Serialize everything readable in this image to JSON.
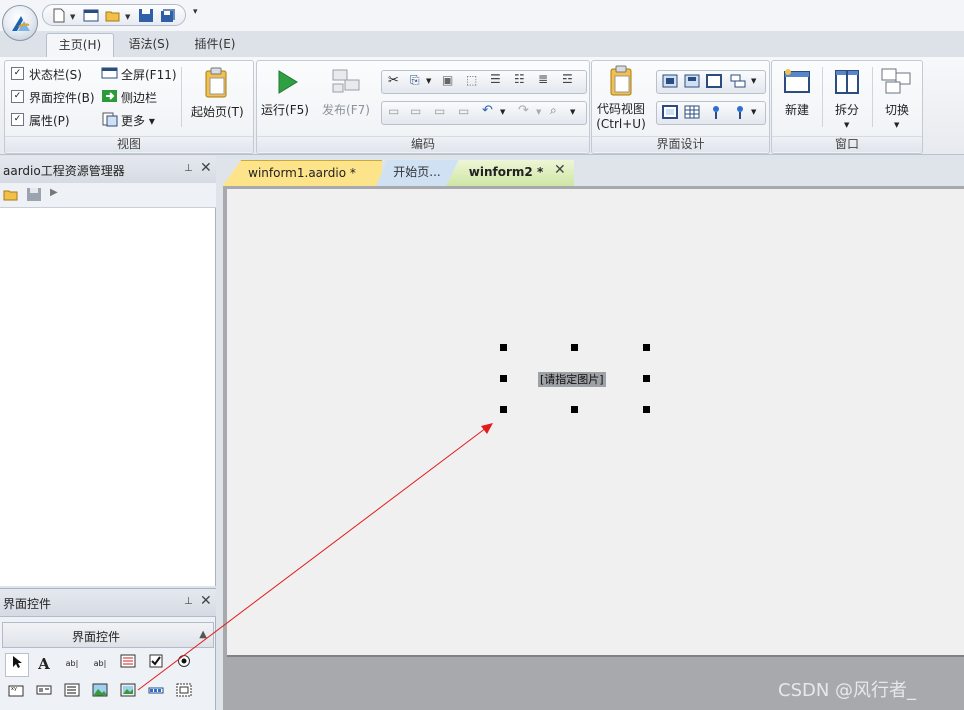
{
  "quick_access": {
    "items": [
      "new-file-icon",
      "form-icon",
      "open-folder-icon",
      "save-icon",
      "save-all-icon"
    ],
    "customize": "▾"
  },
  "ribbon": {
    "tabs": [
      {
        "label": "主页(H)",
        "active": true
      },
      {
        "label": "语法(S)",
        "active": false
      },
      {
        "label": "插件(E)",
        "active": false
      }
    ],
    "view_group": {
      "label": "视图",
      "statusbar": "状态栏(S)",
      "controls": "界面控件(B)",
      "properties": "属性(P)",
      "fullscreen": "全屏(F11)",
      "sidebar": "侧边栏",
      "more": "更多 ▾",
      "start_page": "起始页(T)"
    },
    "run_group": {
      "run": "运行(F5)",
      "publish": "发布(F7)"
    },
    "code_group": {
      "label": "编码"
    },
    "design_group": {
      "label": "界面设计",
      "code_view": "代码视图",
      "code_view_shortcut": "(Ctrl+U)"
    },
    "window_group": {
      "label": "窗口",
      "new": "新建",
      "split": "拆分",
      "switch": "切换"
    }
  },
  "project_panel": {
    "title": "aardio工程资源管理器",
    "pin": "📌",
    "close": "✕"
  },
  "controls_panel": {
    "title": "界面控件",
    "header": "界面控件",
    "pin": "📌",
    "close": "✕",
    "tools_row1": [
      "pointer-icon",
      "A",
      "ab|",
      "ab|",
      "listview-icon",
      "checkbox-icon",
      "radio-icon"
    ],
    "tools_row2": [
      "xy-icon",
      "label-icon",
      "combo-icon",
      "picture-icon",
      "plus-icon",
      "progress-icon",
      "custom-icon"
    ]
  },
  "doc_tabs": [
    {
      "label": "winform1.aardio *"
    },
    {
      "label": "开始页..."
    },
    {
      "label": "winform2 *",
      "active": true
    }
  ],
  "doc_tab_close": "✕",
  "designer": {
    "picturebox_label": "[请指定图片]"
  },
  "watermark": "CSDN @风行者_",
  "colors": {
    "annotation_arrow": "#e31b1b",
    "active_tab": "#cfe6a5",
    "modified_tab": "#fde38a"
  }
}
